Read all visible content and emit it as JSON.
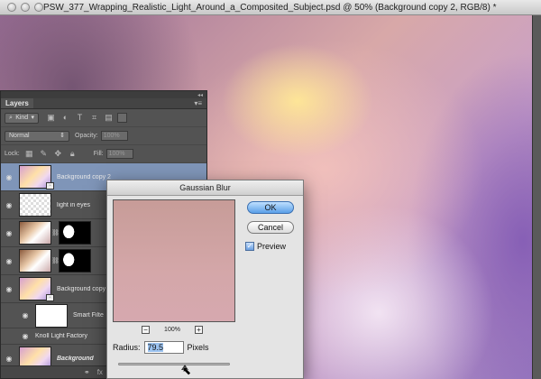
{
  "document": {
    "title": "PSW_377_Wrapping_Realistic_Light_Around_a_Composited_Subject.psd @ 50% (Background copy 2, RGB/8) *"
  },
  "layers_panel": {
    "tab": "Layers",
    "filter_kind": "Kind",
    "blend_mode": "Normal",
    "opacity_label": "Opacity:",
    "opacity_value": "100%",
    "lock_label": "Lock:",
    "fill_label": "Fill:",
    "fill_value": "100%",
    "layers": [
      {
        "name": "Background copy 2",
        "thumb": "glow",
        "selected": true
      },
      {
        "name": "light in eyes",
        "thumb": "checker"
      },
      {
        "name": "...",
        "thumb": "photo",
        "mask": true
      },
      {
        "name": "...",
        "thumb": "photo",
        "mask": true
      },
      {
        "name": "Background copy",
        "thumb": "glow"
      }
    ],
    "smart_filters_label": "Smart Filte",
    "smart_filter_item": "Knoll Light Factory",
    "background_layer": "Background"
  },
  "dialog": {
    "title": "Gaussian Blur",
    "ok_label": "OK",
    "cancel_label": "Cancel",
    "preview_label": "Preview",
    "preview_checked": true,
    "zoom_value": "100%",
    "radius_label": "Radius:",
    "radius_value": "79.5",
    "radius_unit": "Pixels",
    "slider_position_fraction": 0.6
  }
}
